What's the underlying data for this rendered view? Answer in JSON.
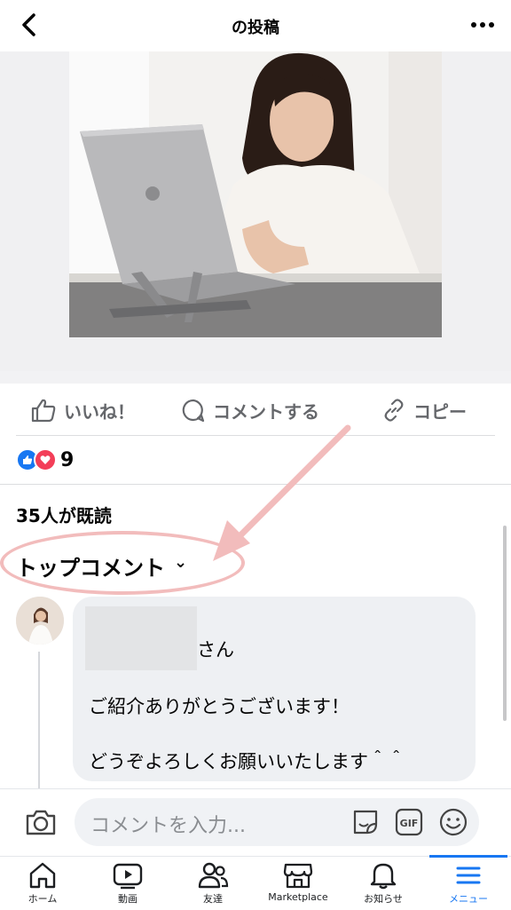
{
  "header": {
    "title": "の投稿"
  },
  "actions": {
    "like": "いいね！",
    "comment": "コメントする",
    "copy": "コピー"
  },
  "reactions": {
    "count": "9"
  },
  "readers": "35人が既読",
  "top_comments": {
    "label": "トップコメント",
    "chevron": "⌄"
  },
  "comment": {
    "name_suffix": "さん",
    "line1": "ご紹介ありがとうございます！",
    "line2": "どうぞよろしくお願いいたします＾＾"
  },
  "input": {
    "placeholder": "コメントを入力..."
  },
  "tabs": [
    {
      "label": "ホーム"
    },
    {
      "label": "動画"
    },
    {
      "label": "友達"
    },
    {
      "label": "Marketplace"
    },
    {
      "label": "お知らせ"
    },
    {
      "label": "メニュー"
    }
  ],
  "colors": {
    "accent": "#1877f2",
    "annotation": "#f2bcbc",
    "like_blue": "#1877f2",
    "love_red": "#f33e58"
  }
}
